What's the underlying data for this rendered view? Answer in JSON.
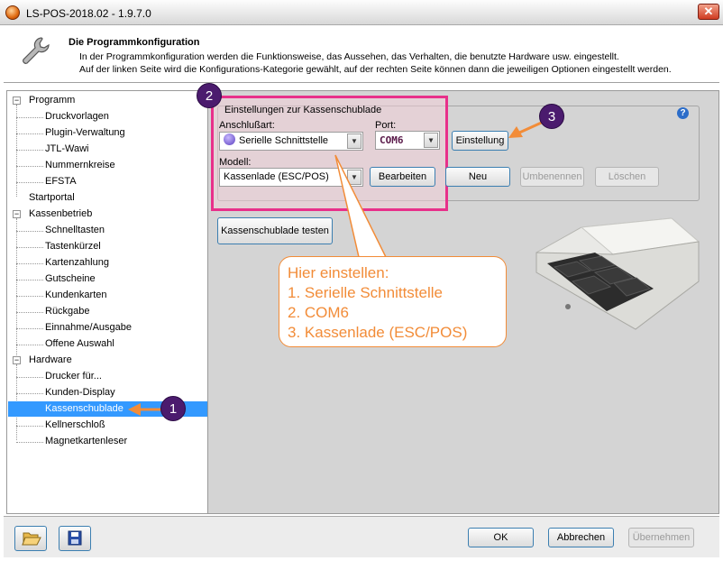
{
  "window": {
    "title": "LS-POS-2018.02 - 1.9.7.0",
    "close_label": "✕"
  },
  "header": {
    "title": "Die Programmkonfiguration",
    "desc_line1": "In der Programmkonfiguration werden die Funktionsweise, das Aussehen, das Verhalten, die benutzte Hardware usw. eingestellt.",
    "desc_line2": "Auf der linken Seite wird die Konfigurations-Kategorie gewählt, auf der rechten Seite können dann die jeweiligen Optionen eingestellt werden."
  },
  "tree": {
    "programm": "Programm",
    "druckvorlagen": "Druckvorlagen",
    "plugin": "Plugin-Verwaltung",
    "jtl": "JTL-Wawi",
    "nummernkreise": "Nummernkreise",
    "efsta": "EFSTA",
    "startportal": "Startportal",
    "kassenbetrieb": "Kassenbetrieb",
    "schnelltasten": "Schnelltasten",
    "tastenkuerzel": "Tastenkürzel",
    "kartenzahlung": "Kartenzahlung",
    "gutscheine": "Gutscheine",
    "kundenkarten": "Kundenkarten",
    "rueckgabe": "Rückgabe",
    "einnahme": "Einnahme/Ausgabe",
    "offene": "Offene Auswahl",
    "hardware": "Hardware",
    "drucker": "Drucker für...",
    "kundendisplay": "Kunden-Display",
    "kassenschublade": "Kassenschublade",
    "kellnerschloss": "Kellnerschloß",
    "magnetkarten": "Magnetkartenleser"
  },
  "settings": {
    "group_title": "Einstellungen zur Kassenschublade",
    "anschluss_label": "Anschlußart:",
    "anschluss_value": "Serielle Schnittstelle",
    "port_label": "Port:",
    "port_value": "COM6",
    "modell_label": "Modell:",
    "modell_value": "Kassenlade (ESC/POS)",
    "bearbeiten": "Bearbeiten",
    "einstellung": "Einstellung",
    "neu": "Neu",
    "umbenennen": "Umbenennen",
    "loeschen": "Löschen",
    "test_button": "Kassenschublade testen",
    "help": "?"
  },
  "callout": {
    "line1": "Hier einstellen:",
    "line2": "1. Serielle Schnittstelle",
    "line3": "2. COM6",
    "line4": "3. Kassenlade (ESC/POS)"
  },
  "badges": {
    "b1": "1",
    "b2": "2",
    "b3": "3"
  },
  "footer": {
    "ok": "OK",
    "abbrechen": "Abbrechen",
    "uebernehmen": "Übernehmen"
  },
  "tree_expander": "−",
  "colors": {
    "highlight": "#e8308a",
    "callout": "#f28c38",
    "badge": "#4b1b6e",
    "selection": "#3399ff"
  }
}
